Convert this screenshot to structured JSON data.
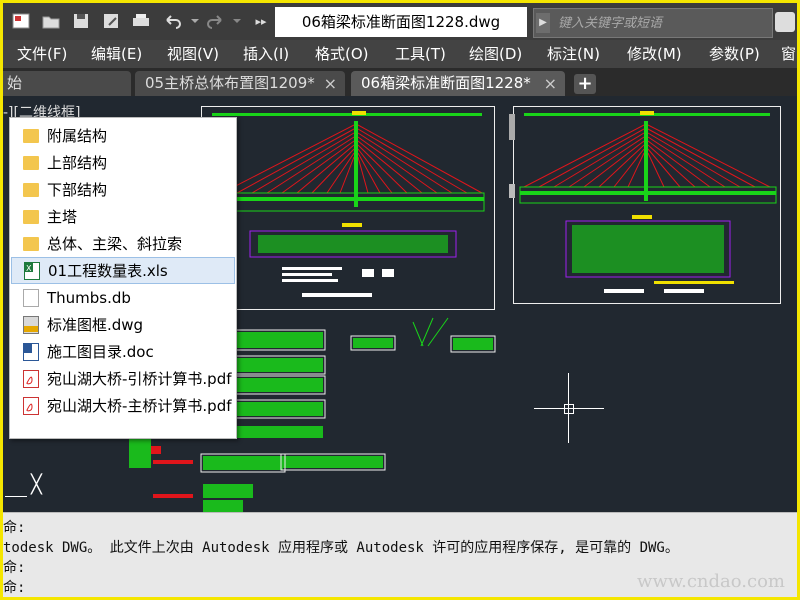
{
  "window": {
    "title": "06箱梁标准断面图1228.dwg",
    "search_placeholder": "键入关键字或短语",
    "qa_more": "▸▸"
  },
  "menu": [
    "文件(F)",
    "编辑(E)",
    "视图(V)",
    "插入(I)",
    "格式(O)",
    "工具(T)",
    "绘图(D)",
    "标注(N)",
    "修改(M)",
    "参数(P)",
    "窗"
  ],
  "tabs": [
    {
      "label": "始",
      "active": false
    },
    {
      "label": "05主桥总体布置图1209*",
      "active": false,
      "close": "×"
    },
    {
      "label": "06箱梁标准断面图1228*",
      "active": true,
      "close": "×"
    }
  ],
  "tab_add": "+",
  "viewport_label": "-][二维线框]",
  "file_list": [
    {
      "name": "附属结构",
      "type": "folder"
    },
    {
      "name": "上部结构",
      "type": "folder"
    },
    {
      "name": "下部结构",
      "type": "folder"
    },
    {
      "name": "主塔",
      "type": "folder"
    },
    {
      "name": "总体、主梁、斜拉索",
      "type": "folder"
    },
    {
      "name": "01工程数量表.xls",
      "type": "xls",
      "selected": true
    },
    {
      "name": "Thumbs.db",
      "type": "db"
    },
    {
      "name": "标准图框.dwg",
      "type": "dwg"
    },
    {
      "name": "施工图目录.doc",
      "type": "doc"
    },
    {
      "name": "宛山湖大桥-引桥计算书.pdf",
      "type": "pdf"
    },
    {
      "name": "宛山湖大桥-主桥计算书.pdf",
      "type": "pdf"
    }
  ],
  "command_lines": [
    "命:",
    "todesk DWG。  此文件上次由 Autodesk 应用程序或 Autodesk 许可的应用程序保存, 是可靠的 DWG。",
    "命:",
    "命:"
  ],
  "watermark": "www.cndao.com",
  "colors": {
    "frame": "#f5e600",
    "drawing_bg": "#212830",
    "accent_red": "#e0151b",
    "accent_green": "#19d419"
  }
}
